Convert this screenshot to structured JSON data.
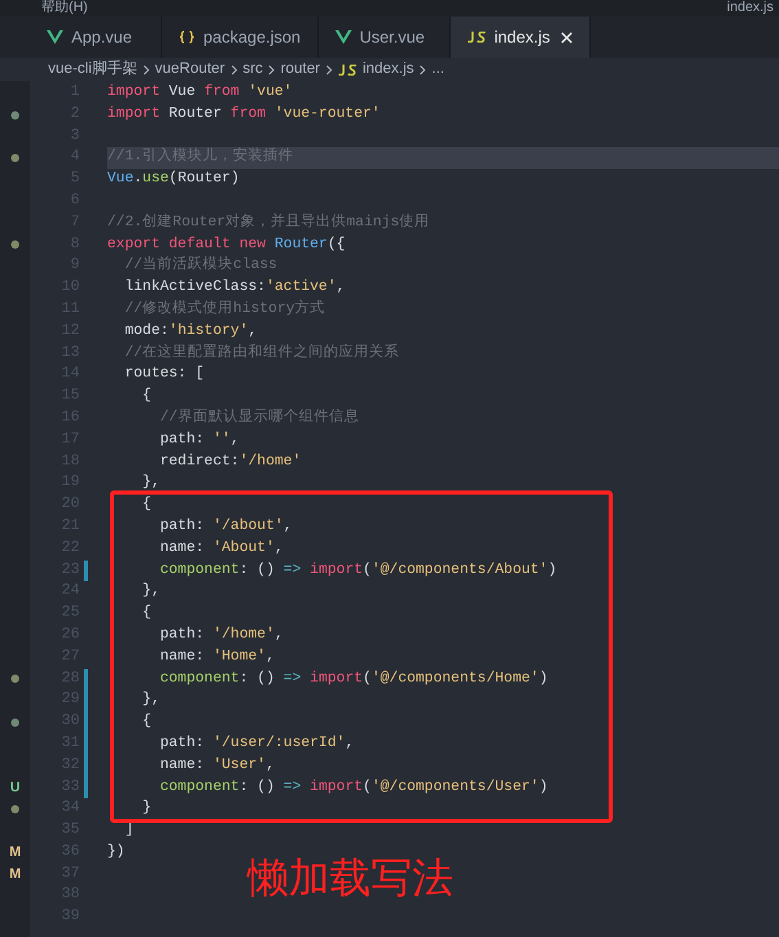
{
  "menu_bar": {
    "items": [
      "帮助(H)"
    ],
    "title": "index.js"
  },
  "tabs": [
    {
      "label": "App.vue",
      "kind": "vue",
      "selected": false
    },
    {
      "label": "package.json",
      "kind": "json",
      "selected": false
    },
    {
      "label": "User.vue",
      "kind": "vue",
      "selected": false
    },
    {
      "label": "index.js",
      "kind": "js",
      "selected": true
    }
  ],
  "breadcrumb": [
    {
      "label": "vue-cli脚手架",
      "kind": "folder"
    },
    {
      "label": "vueRouter",
      "kind": "folder"
    },
    {
      "label": "src",
      "kind": "folder"
    },
    {
      "label": "router",
      "kind": "folder"
    },
    {
      "label": "index.js",
      "kind": "js"
    },
    {
      "label": "...",
      "kind": "folder"
    }
  ],
  "lines": [
    {
      "number": "1",
      "annotated": false,
      "highlighted": false,
      "modified": false,
      "tokens": [
        {
          "kind": "kw",
          "text": "import"
        },
        {
          "kind": "txt",
          "text": " Vue "
        },
        {
          "kind": "kw",
          "text": "from"
        },
        {
          "kind": "str",
          "text": " 'vue'"
        }
      ]
    },
    {
      "number": "2",
      "annotated": false,
      "highlighted": false,
      "modified": false,
      "mark": {
        "kind": "dot",
        "color": "#6e8a74"
      },
      "tokens": [
        {
          "kind": "kw",
          "text": "import"
        },
        {
          "kind": "txt",
          "text": " Router "
        },
        {
          "kind": "kw",
          "text": "from"
        },
        {
          "kind": "str",
          "text": " 'vue-router'"
        }
      ]
    },
    {
      "number": "3",
      "annotated": false,
      "highlighted": false,
      "modified": false
    },
    {
      "number": "4",
      "annotated": false,
      "highlighted": true,
      "modified": false,
      "mark": {
        "kind": "dot",
        "color": "#7f8a6a"
      },
      "tokens": [
        {
          "kind": "cmt",
          "text": "//1.引入模块儿，安装插件"
        }
      ]
    },
    {
      "number": "5",
      "annotated": false,
      "highlighted": false,
      "modified": false,
      "tokens": [
        {
          "kind": "cls",
          "text": "Vue"
        },
        {
          "kind": "txt",
          "text": "."
        },
        {
          "kind": "fn",
          "text": "use"
        },
        {
          "kind": "txt",
          "text": "(Router)"
        }
      ]
    },
    {
      "number": "6",
      "annotated": false,
      "highlighted": false,
      "modified": false
    },
    {
      "number": "7",
      "annotated": false,
      "highlighted": false,
      "modified": false,
      "tokens": [
        {
          "kind": "cmt",
          "text": "//2.创建Router对象，并且导出供mainjs使用"
        }
      ]
    },
    {
      "number": "8",
      "annotated": false,
      "highlighted": false,
      "modified": false,
      "mark": {
        "kind": "dot",
        "color": "#7f8a6a"
      },
      "tokens": [
        {
          "kind": "kw",
          "text": "export default new"
        },
        {
          "kind": "cls",
          "text": " Router"
        },
        {
          "kind": "txt",
          "text": "({"
        }
      ]
    },
    {
      "number": "9",
      "annotated": false,
      "highlighted": false,
      "modified": false,
      "tokens": [
        {
          "kind": "cmt",
          "text": "  //当前活跃模块class"
        }
      ]
    },
    {
      "number": "10",
      "annotated": false,
      "highlighted": false,
      "modified": false,
      "tokens": [
        {
          "kind": "txt",
          "text": "  linkActiveClass:"
        },
        {
          "kind": "str",
          "text": "'active'"
        },
        {
          "kind": "txt",
          "text": ","
        }
      ]
    },
    {
      "number": "11",
      "annotated": false,
      "highlighted": false,
      "modified": false,
      "tokens": [
        {
          "kind": "cmt",
          "text": "  //修改模式使用history方式"
        }
      ]
    },
    {
      "number": "12",
      "annotated": false,
      "highlighted": false,
      "modified": false,
      "tokens": [
        {
          "kind": "txt",
          "text": "  mode:"
        },
        {
          "kind": "str",
          "text": "'history'"
        },
        {
          "kind": "txt",
          "text": ","
        }
      ]
    },
    {
      "number": "13",
      "annotated": false,
      "highlighted": false,
      "modified": false,
      "tokens": [
        {
          "kind": "cmt",
          "text": "  //在这里配置路由和组件之间的应用关系"
        }
      ]
    },
    {
      "number": "14",
      "annotated": false,
      "highlighted": false,
      "modified": false,
      "tokens": [
        {
          "kind": "txt",
          "text": "  routes: ["
        }
      ]
    },
    {
      "number": "15",
      "annotated": false,
      "highlighted": false,
      "modified": false,
      "tokens": [
        {
          "kind": "txt",
          "text": "    {"
        }
      ]
    },
    {
      "number": "16",
      "annotated": false,
      "highlighted": false,
      "modified": false,
      "tokens": [
        {
          "kind": "cmt",
          "text": "      //界面默认显示哪个组件信息"
        }
      ]
    },
    {
      "number": "17",
      "annotated": false,
      "highlighted": false,
      "modified": false,
      "tokens": [
        {
          "kind": "txt",
          "text": "      path: "
        },
        {
          "kind": "str",
          "text": "''"
        },
        {
          "kind": "txt",
          "text": ","
        }
      ]
    },
    {
      "number": "18",
      "annotated": false,
      "highlighted": false,
      "modified": false,
      "tokens": [
        {
          "kind": "txt",
          "text": "      redirect:"
        },
        {
          "kind": "str",
          "text": "'/home'"
        }
      ]
    },
    {
      "number": "19",
      "annotated": false,
      "highlighted": false,
      "modified": false,
      "tokens": [
        {
          "kind": "txt",
          "text": "    },"
        }
      ]
    },
    {
      "number": "20",
      "annotated": true,
      "highlighted": false,
      "modified": false,
      "tokens": [
        {
          "kind": "txt",
          "text": "    {"
        }
      ]
    },
    {
      "number": "21",
      "annotated": true,
      "highlighted": false,
      "modified": false,
      "tokens": [
        {
          "kind": "txt",
          "text": "      path: "
        },
        {
          "kind": "str",
          "text": "'/about'"
        },
        {
          "kind": "txt",
          "text": ","
        }
      ]
    },
    {
      "number": "22",
      "annotated": true,
      "highlighted": false,
      "modified": false,
      "tokens": [
        {
          "kind": "txt",
          "text": "      name: "
        },
        {
          "kind": "str",
          "text": "'About'"
        },
        {
          "kind": "txt",
          "text": ","
        }
      ]
    },
    {
      "number": "23",
      "annotated": true,
      "highlighted": false,
      "modified": true,
      "tokens": [
        {
          "kind": "fn",
          "text": "      component"
        },
        {
          "kind": "txt",
          "text": ": () "
        },
        {
          "kind": "op",
          "text": "=>"
        },
        {
          "kind": "kw",
          "text": " import"
        },
        {
          "kind": "txt",
          "text": "("
        },
        {
          "kind": "str",
          "text": "'@/components/About'"
        },
        {
          "kind": "txt",
          "text": ")"
        }
      ]
    },
    {
      "number": "24",
      "annotated": true,
      "highlighted": false,
      "modified": false,
      "tokens": [
        {
          "kind": "txt",
          "text": "    },"
        }
      ]
    },
    {
      "number": "25",
      "annotated": true,
      "highlighted": false,
      "modified": false,
      "tokens": [
        {
          "kind": "txt",
          "text": "    {"
        }
      ]
    },
    {
      "number": "26",
      "annotated": true,
      "highlighted": false,
      "modified": false,
      "tokens": [
        {
          "kind": "txt",
          "text": "      path: "
        },
        {
          "kind": "str",
          "text": "'/home'"
        },
        {
          "kind": "txt",
          "text": ","
        }
      ]
    },
    {
      "number": "27",
      "annotated": true,
      "highlighted": false,
      "modified": false,
      "tokens": [
        {
          "kind": "txt",
          "text": "      name: "
        },
        {
          "kind": "str",
          "text": "'Home'"
        },
        {
          "kind": "txt",
          "text": ","
        }
      ]
    },
    {
      "number": "28",
      "annotated": true,
      "highlighted": false,
      "modified": true,
      "mark": {
        "kind": "dot",
        "color": "#7f8a6a"
      },
      "tokens": [
        {
          "kind": "fn",
          "text": "      component"
        },
        {
          "kind": "txt",
          "text": ": () "
        },
        {
          "kind": "op",
          "text": "=>"
        },
        {
          "kind": "kw",
          "text": " import"
        },
        {
          "kind": "txt",
          "text": "("
        },
        {
          "kind": "str",
          "text": "'@/components/Home'"
        },
        {
          "kind": "txt",
          "text": ")"
        }
      ]
    },
    {
      "number": "29",
      "annotated": true,
      "highlighted": false,
      "modified": true,
      "tokens": [
        {
          "kind": "txt",
          "text": "    },"
        }
      ]
    },
    {
      "number": "30",
      "annotated": true,
      "highlighted": false,
      "modified": true,
      "mark": {
        "kind": "dot",
        "color": "#6e8a74"
      },
      "tokens": [
        {
          "kind": "txt",
          "text": "    {"
        }
      ]
    },
    {
      "number": "31",
      "annotated": true,
      "highlighted": false,
      "modified": true,
      "tokens": [
        {
          "kind": "txt",
          "text": "      path: "
        },
        {
          "kind": "str",
          "text": "'/user/:userId'"
        },
        {
          "kind": "txt",
          "text": ","
        }
      ]
    },
    {
      "number": "32",
      "annotated": true,
      "highlighted": false,
      "modified": true,
      "tokens": [
        {
          "kind": "txt",
          "text": "      name: "
        },
        {
          "kind": "str",
          "text": "'User'"
        },
        {
          "kind": "txt",
          "text": ","
        }
      ]
    },
    {
      "number": "33",
      "annotated": true,
      "highlighted": false,
      "modified": true,
      "mark": {
        "kind": "letter",
        "text": "U",
        "color": "#73c991"
      },
      "tokens": [
        {
          "kind": "fn",
          "text": "      component"
        },
        {
          "kind": "txt",
          "text": ": () "
        },
        {
          "kind": "op",
          "text": "=>"
        },
        {
          "kind": "kw",
          "text": " import"
        },
        {
          "kind": "txt",
          "text": "("
        },
        {
          "kind": "str",
          "text": "'@/components/User'"
        },
        {
          "kind": "txt",
          "text": ")"
        }
      ]
    },
    {
      "number": "34",
      "annotated": true,
      "highlighted": false,
      "modified": false,
      "mark": {
        "kind": "dot",
        "color": "#7f8a6a"
      },
      "tokens": [
        {
          "kind": "txt",
          "text": "    }"
        }
      ]
    },
    {
      "number": "35",
      "annotated": false,
      "highlighted": false,
      "modified": false,
      "tokens": [
        {
          "kind": "txt",
          "text": "  ]"
        }
      ]
    },
    {
      "number": "36",
      "annotated": false,
      "highlighted": false,
      "modified": false,
      "mark": {
        "kind": "letter",
        "text": "M",
        "color": "#e2c08d"
      },
      "tokens": [
        {
          "kind": "txt",
          "text": "})"
        }
      ]
    },
    {
      "number": "37",
      "annotated": false,
      "highlighted": false,
      "modified": false,
      "mark": {
        "kind": "letter",
        "text": "M",
        "color": "#e2c08d"
      }
    },
    {
      "number": "38",
      "annotated": false,
      "highlighted": false,
      "modified": false
    },
    {
      "number": "39",
      "annotated": false,
      "highlighted": false,
      "modified": false
    }
  ],
  "annotation": {
    "caption": "懒加载写法"
  }
}
